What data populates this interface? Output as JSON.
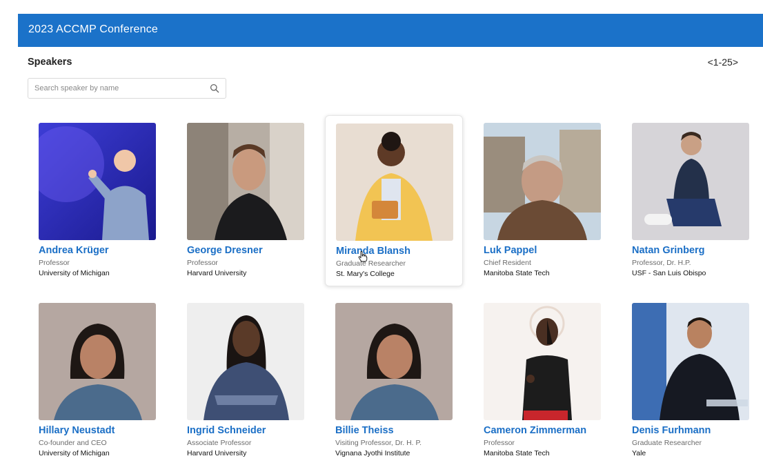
{
  "header": {
    "title": "2023 ACCMP Conference"
  },
  "section": {
    "title": "Speakers",
    "pagination": "<1-25>"
  },
  "search": {
    "placeholder": "Search speaker by name",
    "value": "",
    "icon": "search-icon"
  },
  "colors": {
    "brand": "#1b72c9",
    "link": "#1b6fc6"
  },
  "speakers": [
    {
      "name": "Andrea Krüger",
      "title": "Professor",
      "org": "University of Michigan"
    },
    {
      "name": "George Dresner",
      "title": "Professor",
      "org": "Harvard University"
    },
    {
      "name": "Miranda Blansh",
      "title": "Graduate Researcher",
      "org": "St. Mary's College"
    },
    {
      "name": "Luk Pappel",
      "title": "Chief Resident",
      "org": "Manitoba State Tech"
    },
    {
      "name": "Natan Grinberg",
      "title": "Professor, Dr. H.P.",
      "org": "USF - San Luis Obispo"
    },
    {
      "name": "Hillary Neustadt",
      "title": "Co-founder and CEO",
      "org": "University of Michigan"
    },
    {
      "name": "Ingrid Schneider",
      "title": "Associate Professor",
      "org": "Harvard University"
    },
    {
      "name": "Billie Theiss",
      "title": "Visiting Professor, Dr. H. P.",
      "org": "Vignana Jyothi Institute"
    },
    {
      "name": "Cameron Zimmerman",
      "title": "Professor",
      "org": "Manitoba State Tech"
    },
    {
      "name": "Denis Furhmann",
      "title": "Graduate Researcher",
      "org": "Yale"
    }
  ]
}
